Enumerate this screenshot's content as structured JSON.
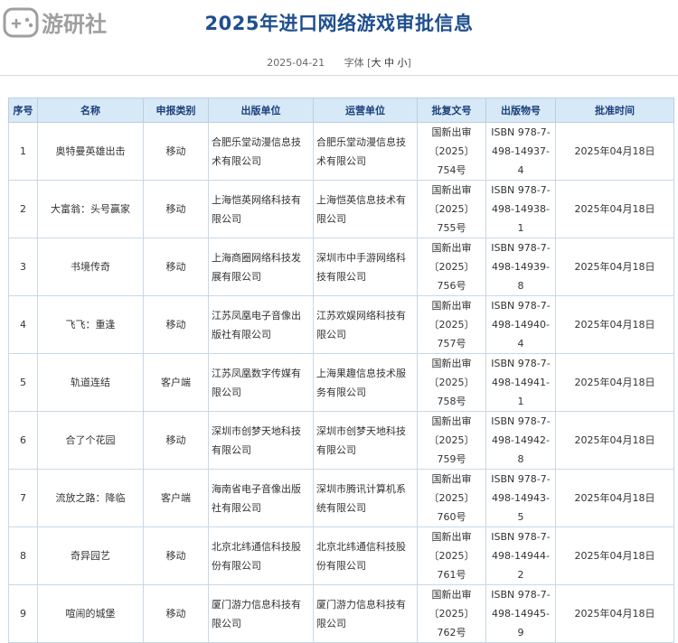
{
  "page": {
    "title": "2025年进口网络游戏审批信息",
    "date": "2025-04-21",
    "font_label": "字体",
    "font_bracket_open": "[",
    "font_bracket_close": "]",
    "font_sizes": [
      "大",
      "中",
      "小"
    ]
  },
  "watermark": {
    "text": "游研社",
    "icon": "gamepad-icon"
  },
  "table": {
    "headers": [
      "序号",
      "名称",
      "申报类别",
      "出版单位",
      "运营单位",
      "批复文号",
      "出版物号",
      "批准时间"
    ],
    "rows": [
      {
        "no": "1",
        "name": "奥特曼英雄出击",
        "category": "移动",
        "publisher": "合肥乐堂动漫信息技术有限公司",
        "operator": "合肥乐堂动漫信息技术有限公司",
        "approval_no": "国新出审〔2025〕754号",
        "isbn": "ISBN 978-7-498-14937-4",
        "date": "2025年04月18日"
      },
      {
        "no": "2",
        "name": "大富翁：头号赢家",
        "category": "移动",
        "publisher": "上海恺英网络科技有限公司",
        "operator": "上海恺英信息技术有限公司",
        "approval_no": "国新出审〔2025〕755号",
        "isbn": "ISBN 978-7-498-14938-1",
        "date": "2025年04月18日"
      },
      {
        "no": "3",
        "name": "书境传奇",
        "category": "移动",
        "publisher": "上海商圈网络科技发展有限公司",
        "operator": "深圳市中手游网络科技有限公司",
        "approval_no": "国新出审〔2025〕756号",
        "isbn": "ISBN 978-7-498-14939-8",
        "date": "2025年04月18日"
      },
      {
        "no": "4",
        "name": "飞飞：重逢",
        "category": "移动",
        "publisher": "江苏凤凰电子音像出版社有限公司",
        "operator": "江苏欢娱网络科技有限公司",
        "approval_no": "国新出审〔2025〕757号",
        "isbn": "ISBN 978-7-498-14940-4",
        "date": "2025年04月18日"
      },
      {
        "no": "5",
        "name": "轨道连结",
        "category": "客户端",
        "publisher": "江苏凤凰数字传媒有限公司",
        "operator": "上海果趣信息技术服务有限公司",
        "approval_no": "国新出审〔2025〕758号",
        "isbn": "ISBN 978-7-498-14941-1",
        "date": "2025年04月18日"
      },
      {
        "no": "6",
        "name": "合了个花园",
        "category": "移动",
        "publisher": "深圳市创梦天地科技有限公司",
        "operator": "深圳市创梦天地科技有限公司",
        "approval_no": "国新出审〔2025〕759号",
        "isbn": "ISBN 978-7-498-14942-8",
        "date": "2025年04月18日"
      },
      {
        "no": "7",
        "name": "流放之路：降临",
        "category": "客户端",
        "publisher": "海南省电子音像出版社有限公司",
        "operator": "深圳市腾讯计算机系统有限公司",
        "approval_no": "国新出审〔2025〕760号",
        "isbn": "ISBN 978-7-498-14943-5",
        "date": "2025年04月18日"
      },
      {
        "no": "8",
        "name": "奇异园艺",
        "category": "移动",
        "publisher": "北京北纬通信科技股份有限公司",
        "operator": "北京北纬通信科技股份有限公司",
        "approval_no": "国新出审〔2025〕761号",
        "isbn": "ISBN 978-7-498-14944-2",
        "date": "2025年04月18日"
      },
      {
        "no": "9",
        "name": "喧闹的城堡",
        "category": "移动",
        "publisher": "厦门游力信息科技有限公司",
        "operator": "厦门游力信息科技有限公司",
        "approval_no": "国新出审〔2025〕762号",
        "isbn": "ISBN 978-7-498-14945-9",
        "date": "2025年04月18日"
      }
    ]
  }
}
